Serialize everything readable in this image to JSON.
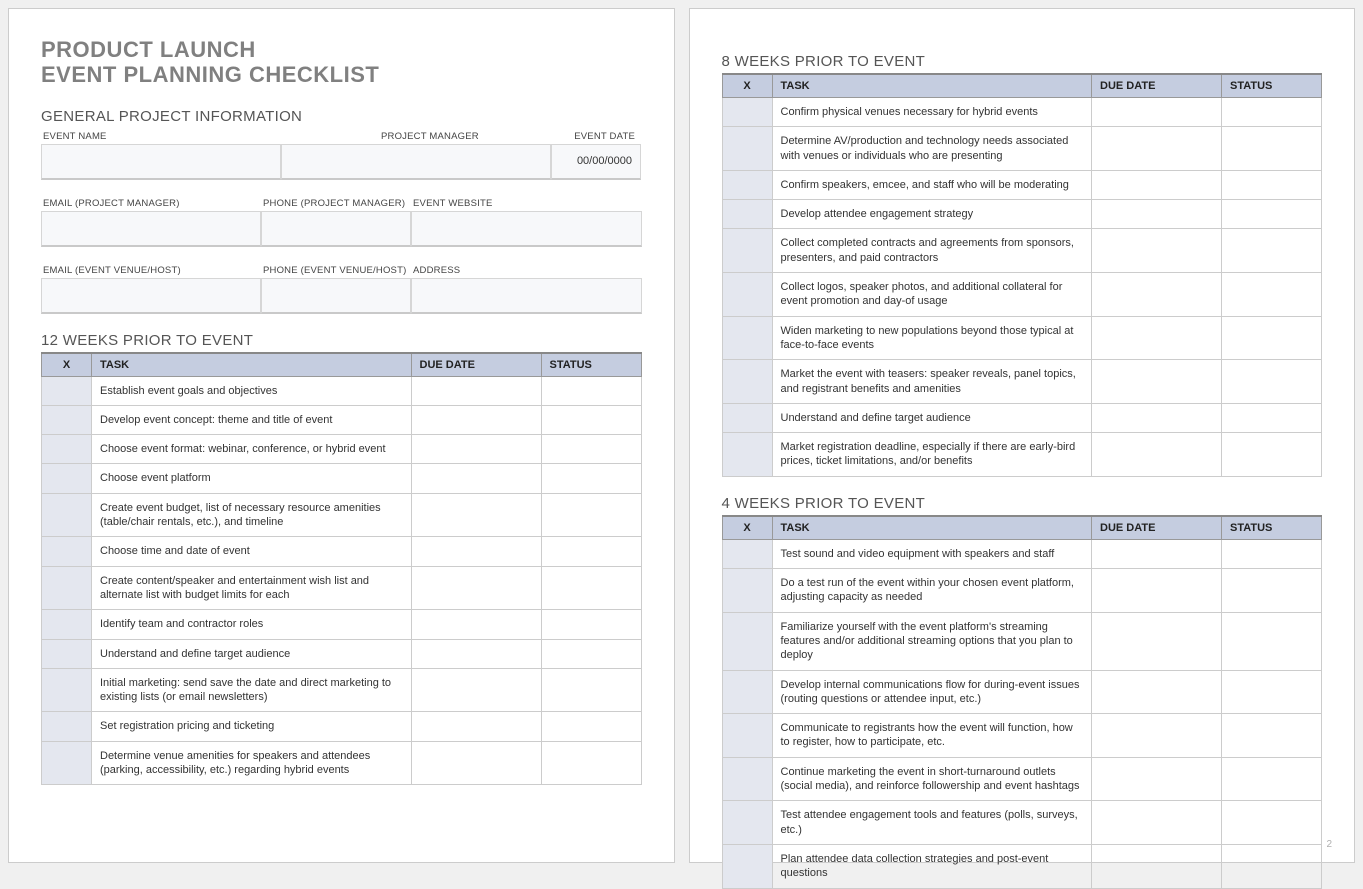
{
  "title_line1": "PRODUCT LAUNCH",
  "title_line2": "EVENT PLANNING CHECKLIST",
  "general_heading": "GENERAL PROJECT INFORMATION",
  "labels": {
    "event_name": "EVENT NAME",
    "project_manager": "PROJECT MANAGER",
    "event_date": "EVENT DATE",
    "email_pm": "EMAIL (PROJECT MANAGER)",
    "phone_pm": "PHONE (PROJECT MANAGER)",
    "event_website": "EVENT WEBSITE",
    "email_venue": "EMAIL (EVENT VENUE/HOST)",
    "phone_venue": "PHONE (EVENT VENUE/HOST)",
    "address": "ADDRESS"
  },
  "values": {
    "event_name": "",
    "project_manager": "",
    "event_date": "00/00/0000",
    "email_pm": "",
    "phone_pm": "",
    "event_website": "",
    "email_venue": "",
    "phone_venue": "",
    "address": ""
  },
  "col_headers": {
    "check": "X",
    "task": "TASK",
    "due": "DUE DATE",
    "status": "STATUS"
  },
  "sections": {
    "w12": {
      "heading": "12 WEEKS PRIOR TO EVENT",
      "tasks": [
        "Establish event goals and objectives",
        "Develop event concept: theme and title of event",
        "Choose event format: webinar, conference, or hybrid event",
        "Choose event platform",
        "Create event budget, list of necessary resource amenities (table/chair rentals, etc.), and timeline",
        "Choose time and date of event",
        "Create content/speaker and entertainment wish list and alternate list with budget limits for each",
        "Identify team and contractor roles",
        "Understand and define target audience",
        "Initial marketing: send save the date and direct marketing to existing lists (or email newsletters)",
        "Set registration pricing and ticketing",
        "Determine venue amenities for speakers and attendees (parking, accessibility, etc.) regarding hybrid events"
      ]
    },
    "w8": {
      "heading": "8 WEEKS PRIOR TO EVENT",
      "tasks": [
        "Confirm physical venues necessary for hybrid events",
        "Determine AV/production and technology needs associated with venues or individuals who are presenting",
        "Confirm speakers, emcee, and staff who will be moderating",
        "Develop attendee engagement strategy",
        "Collect completed contracts and agreements from sponsors, presenters, and paid contractors",
        "Collect logos, speaker photos, and additional collateral for event promotion and day-of usage",
        "Widen marketing to new populations beyond those typical at face-to-face events",
        "Market the event with teasers: speaker reveals, panel topics, and registrant benefits and amenities",
        "Understand and define target audience",
        "Market registration deadline, especially if there are early-bird prices, ticket limitations, and/or benefits"
      ]
    },
    "w4": {
      "heading": "4 WEEKS PRIOR TO EVENT",
      "tasks": [
        "Test sound and video equipment with speakers and staff",
        "Do a test run of the event within your chosen event platform, adjusting capacity as needed",
        "Familiarize yourself with the event platform's streaming features and/or additional streaming options that you plan to deploy",
        "Develop internal communications flow for during-event issues (routing questions or attendee input, etc.)",
        "Communicate to registrants how the event will function, how to register, how to participate, etc.",
        "Continue marketing the event in short-turnaround outlets (social media), and reinforce followership and event hashtags",
        "Test attendee engagement tools and features (polls, surveys, etc.)",
        "Plan attendee data collection strategies and post-event questions"
      ]
    }
  },
  "page_number": "2"
}
